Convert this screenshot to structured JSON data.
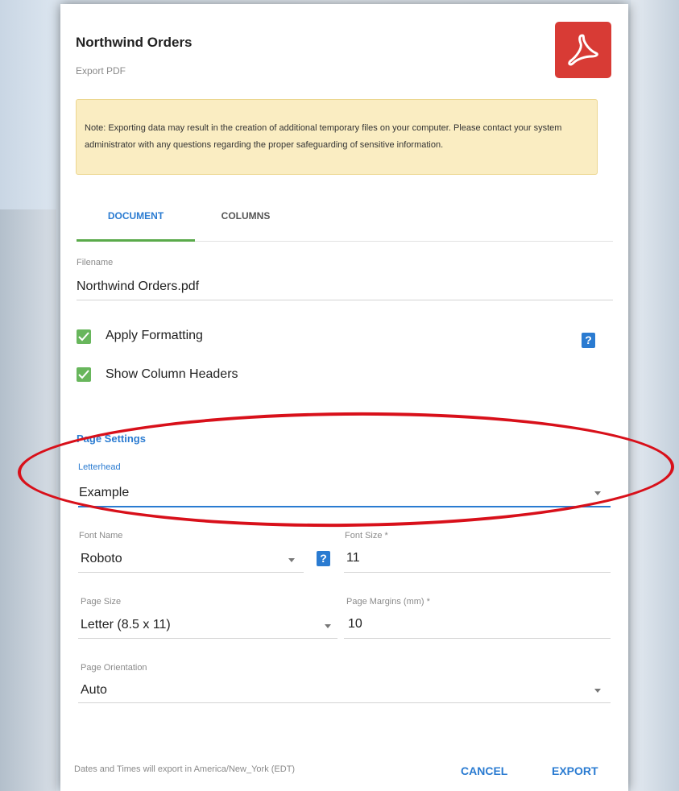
{
  "dialog": {
    "title": "Northwind Orders",
    "subtitle": "Export PDF",
    "icon": "pdf-file-icon",
    "note": "Note: Exporting data may result in the creation of additional temporary files on your computer. Please contact your system administrator with any questions regarding the proper safeguarding of sensitive information."
  },
  "tabs": [
    {
      "label": "DOCUMENT",
      "active": true
    },
    {
      "label": "COLUMNS",
      "active": false
    }
  ],
  "filename": {
    "label": "Filename",
    "value": "Northwind Orders.pdf"
  },
  "options": {
    "apply_formatting": {
      "label": "Apply Formatting",
      "checked": true
    },
    "show_column_headers": {
      "label": "Show Column Headers",
      "checked": true
    }
  },
  "page_settings": {
    "title": "Page Settings",
    "letterhead": {
      "label": "Letterhead",
      "value": "Example"
    },
    "font_name": {
      "label": "Font Name",
      "value": "Roboto"
    },
    "font_size": {
      "label": "Font Size *",
      "value": "11"
    },
    "page_size": {
      "label": "Page Size",
      "value": "Letter (8.5 x 11)"
    },
    "page_margins": {
      "label": "Page Margins (mm) *",
      "value": "10"
    },
    "page_orientation": {
      "label": "Page Orientation",
      "value": "Auto"
    }
  },
  "footer": {
    "timezone_note": "Dates and Times will export in America/New_York (EDT)",
    "cancel_label": "CANCEL",
    "export_label": "EXPORT"
  },
  "colors": {
    "accent": "#2a7bd1",
    "checkbox": "#68b65c",
    "tab_indicator": "#5aaa4a",
    "pdf_badge": "#d83b35",
    "note_background": "#faedc2",
    "annotation": "#d8101a"
  }
}
